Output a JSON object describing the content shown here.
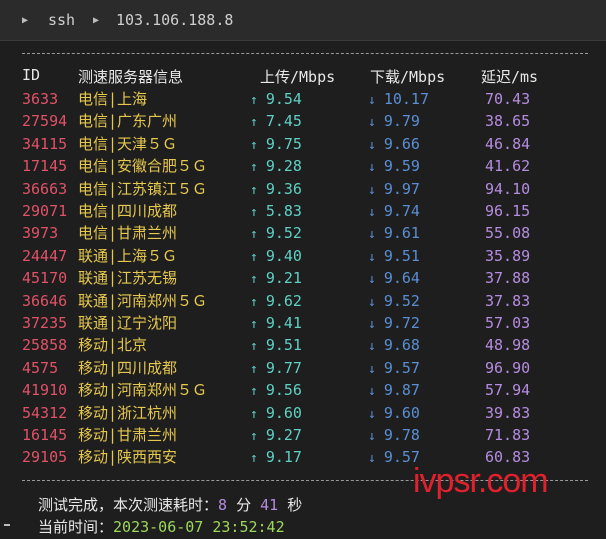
{
  "breadcrumb": {
    "segment1": "ssh",
    "segment2": "103.106.188.8"
  },
  "table": {
    "headers": {
      "id": "ID",
      "server": "测速服务器信息",
      "upload": "上传/Mbps",
      "download": "下载/Mbps",
      "latency": "延迟/ms"
    },
    "rows": [
      {
        "id": "3633",
        "server": "电信|上海",
        "upload": "9.54",
        "download": "10.17",
        "latency": "70.43"
      },
      {
        "id": "27594",
        "server": "电信|广东广州",
        "upload": "7.45",
        "download": "9.79",
        "latency": "38.65"
      },
      {
        "id": "34115",
        "server": "电信|天津５Ｇ",
        "upload": "9.75",
        "download": "9.66",
        "latency": "46.84"
      },
      {
        "id": "17145",
        "server": "电信|安徽合肥５Ｇ",
        "upload": "9.28",
        "download": "9.59",
        "latency": "41.62"
      },
      {
        "id": "36663",
        "server": "电信|江苏镇江５Ｇ",
        "upload": "9.36",
        "download": "9.97",
        "latency": "94.10"
      },
      {
        "id": "29071",
        "server": "电信|四川成都",
        "upload": "5.83",
        "download": "9.74",
        "latency": "96.15"
      },
      {
        "id": "3973",
        "server": "电信|甘肃兰州",
        "upload": "9.52",
        "download": "9.61",
        "latency": "55.08"
      },
      {
        "id": "24447",
        "server": "联通|上海５Ｇ",
        "upload": "9.40",
        "download": "9.51",
        "latency": "35.89"
      },
      {
        "id": "45170",
        "server": "联通|江苏无锡",
        "upload": "9.21",
        "download": "9.64",
        "latency": "37.88"
      },
      {
        "id": "36646",
        "server": "联通|河南郑州５Ｇ",
        "upload": "9.62",
        "download": "9.52",
        "latency": "37.83"
      },
      {
        "id": "37235",
        "server": "联通|辽宁沈阳",
        "upload": "9.41",
        "download": "9.72",
        "latency": "57.03"
      },
      {
        "id": "25858",
        "server": "移动|北京",
        "upload": "9.51",
        "download": "9.68",
        "latency": "48.98"
      },
      {
        "id": "4575",
        "server": "移动|四川成都",
        "upload": "9.77",
        "download": "9.57",
        "latency": "96.90"
      },
      {
        "id": "41910",
        "server": "移动|河南郑州５Ｇ",
        "upload": "9.56",
        "download": "9.87",
        "latency": "57.94"
      },
      {
        "id": "54312",
        "server": "移动|浙江杭州",
        "upload": "9.60",
        "download": "9.60",
        "latency": "39.83"
      },
      {
        "id": "16145",
        "server": "移动|甘肃兰州",
        "upload": "9.27",
        "download": "9.78",
        "latency": "71.83"
      },
      {
        "id": "29105",
        "server": "移动|陕西西安",
        "upload": "9.17",
        "download": "9.57",
        "latency": "60.83"
      }
    ]
  },
  "footer": {
    "done_label": "测试完成，本次测速耗时：",
    "minutes": "8",
    "minutes_unit": "分",
    "seconds": "41",
    "seconds_unit": "秒",
    "time_label": "当前时间：",
    "time_value": "2023-06-07 23:52:42"
  },
  "watermark": "ivpsr.com",
  "colors": {
    "id": "#e05267",
    "server": "#e6c84e",
    "upload": "#5fd0c4",
    "download": "#5a8fd4",
    "latency": "#b58ce0",
    "time": "#9cd85a"
  }
}
